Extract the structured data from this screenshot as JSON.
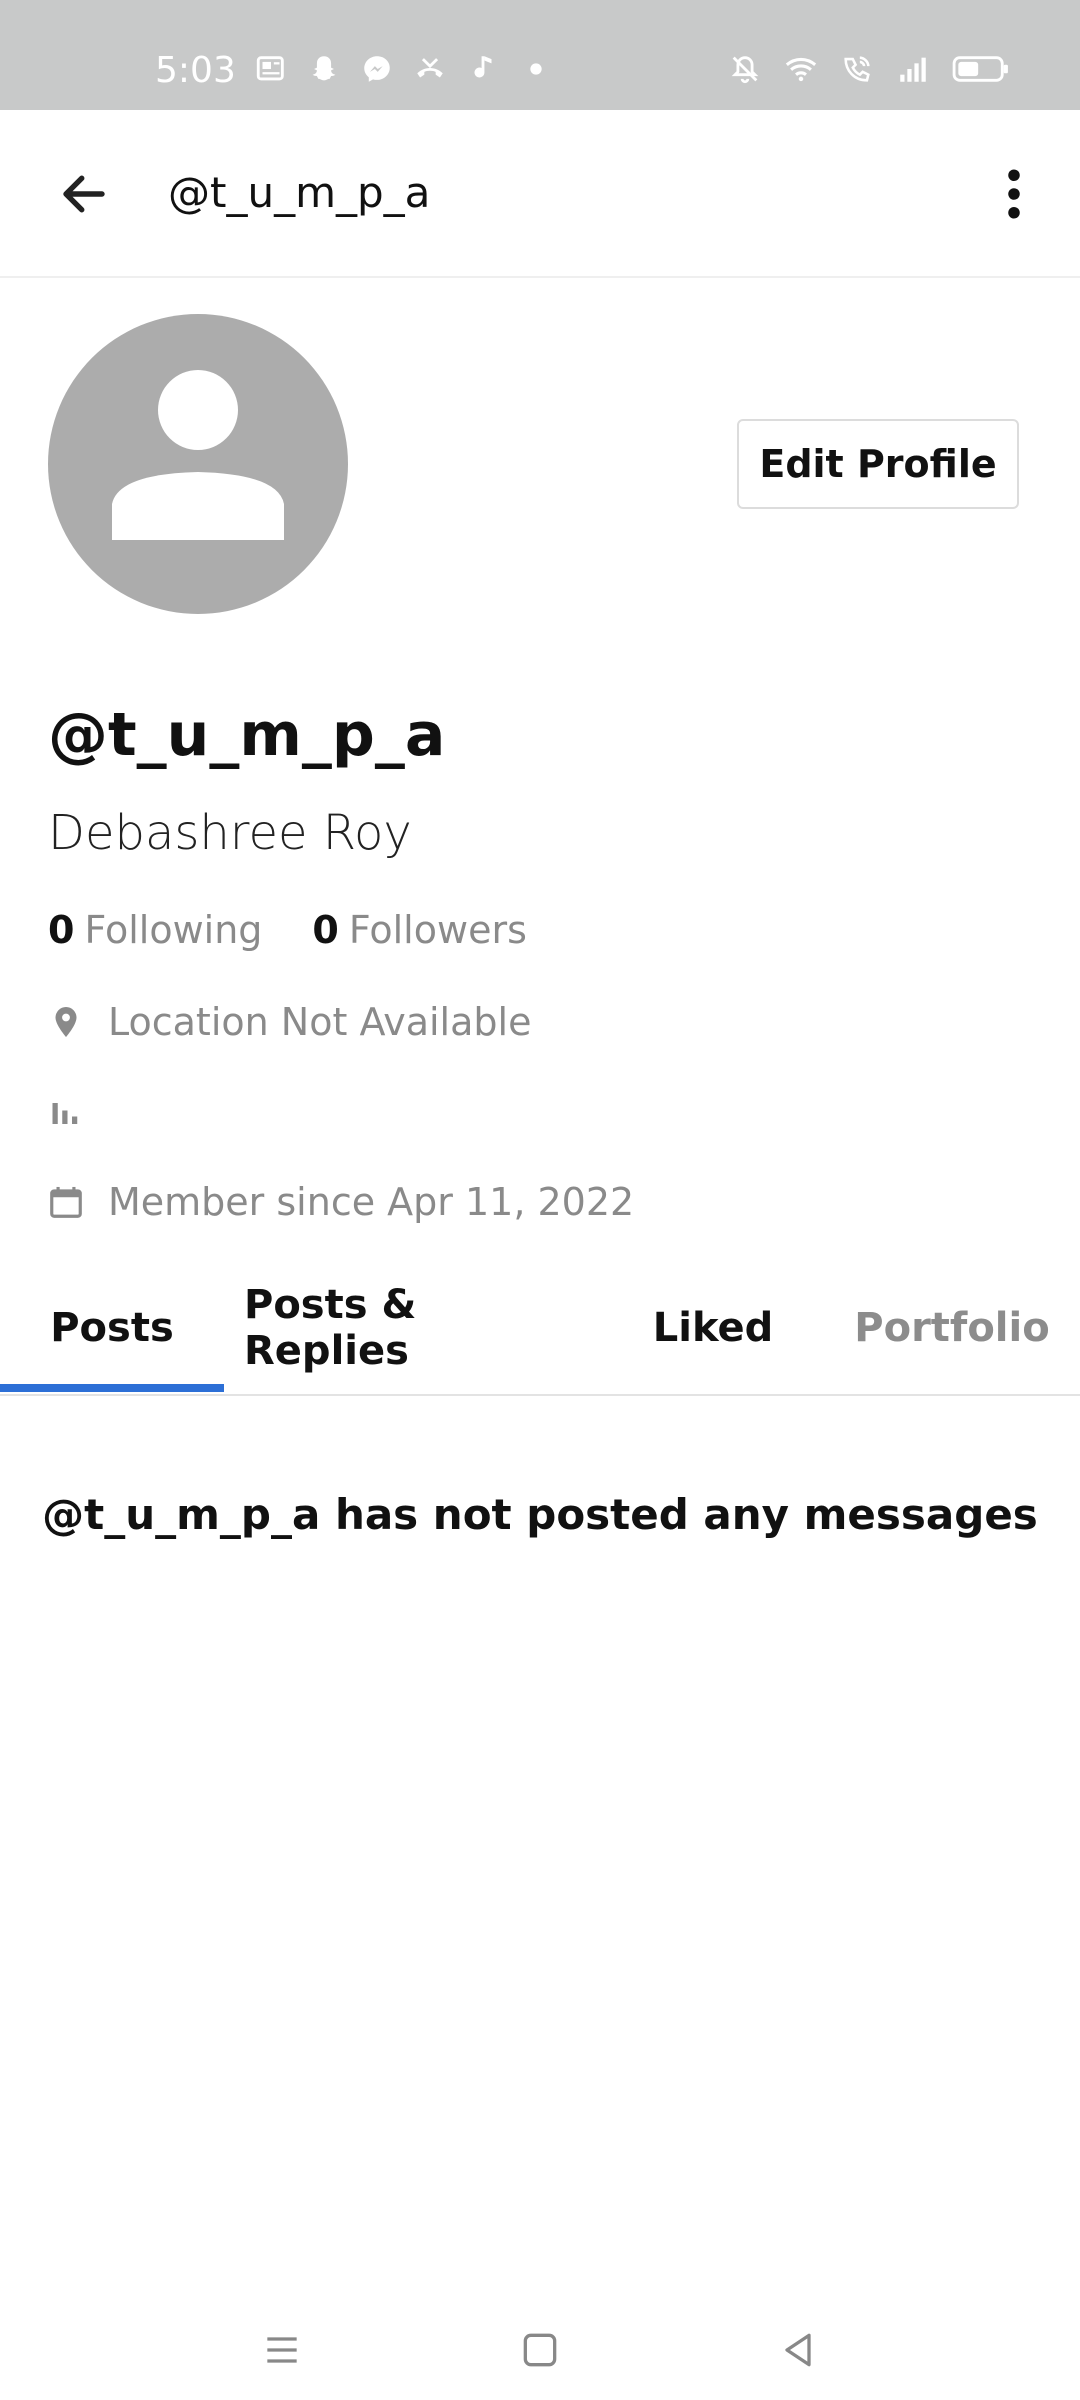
{
  "status_bar": {
    "time": "5:03",
    "left_icons": [
      "news-icon",
      "snapchat-icon",
      "messenger-icon",
      "missed-call-icon",
      "music-note-icon",
      "dot-icon"
    ],
    "right_icons": [
      "mute-bell-icon",
      "wifi-icon",
      "wifi-calling-icon",
      "signal-icon",
      "battery-icon"
    ]
  },
  "app_bar": {
    "title": "@t_u_m_p_a"
  },
  "profile": {
    "edit_button": "Edit Profile",
    "handle": "@t_u_m_p_a",
    "full_name": "Debashree Roy",
    "following_count": "0",
    "following_label": "Following",
    "followers_count": "0",
    "followers_label": "Followers",
    "location": "Location Not Available",
    "member_since": "Member since Apr 11, 2022"
  },
  "tabs": [
    {
      "label": "Posts",
      "active": true
    },
    {
      "label": "Posts & Replies",
      "active": false
    },
    {
      "label": "Liked",
      "active": false
    },
    {
      "label": "Portfolio",
      "active": false
    }
  ],
  "empty_message": "@t_u_m_p_a has not posted any messages",
  "colors": {
    "accent": "#2c6fd6",
    "status_bar": "#c8c9c9",
    "avatar": "#acacac",
    "muted_text": "#8a8a8a"
  }
}
